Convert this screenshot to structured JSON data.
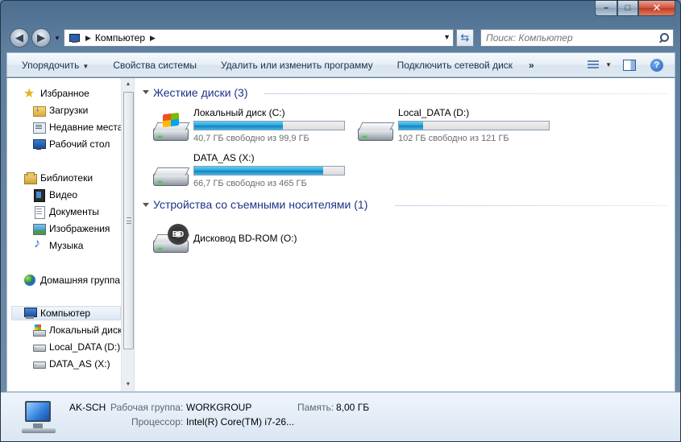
{
  "window": {
    "min": "–",
    "max": "□",
    "close": "✕"
  },
  "address": {
    "path": "Компьютер",
    "search_placeholder": "Поиск: Компьютер"
  },
  "toolbar": {
    "organize": "Упорядочить",
    "system_properties": "Свойства системы",
    "uninstall": "Удалить или изменить программу",
    "map_drive": "Подключить сетевой диск",
    "more": "»"
  },
  "nav": {
    "favorites": "Избранное",
    "downloads": "Загрузки",
    "recent": "Недавние места",
    "desktop": "Рабочий стол",
    "libraries": "Библиотеки",
    "video": "Видео",
    "documents": "Документы",
    "images": "Изображения",
    "music": "Музыка",
    "homegroup": "Домашняя группа",
    "computer": "Компьютер",
    "drive_c": "Локальный диск",
    "drive_d": "Local_DATA (D:)",
    "drive_x": "DATA_AS (X:)"
  },
  "groups": {
    "hdd": "Жесткие диски (3)",
    "removable": "Устройства со съемными носителями (1)"
  },
  "drives": [
    {
      "name": "Локальный диск (C:)",
      "free": "40,7 ГБ свободно из 99,9 ГБ",
      "used_fraction": 0.59
    },
    {
      "name": "Local_DATA (D:)",
      "free": "102 ГБ свободно из 121 ГБ",
      "used_fraction": 0.16
    },
    {
      "name": "DATA_AS (X:)",
      "free": "66,7 ГБ свободно из 465 ГБ",
      "used_fraction": 0.86
    }
  ],
  "removable": {
    "name": "Дисковод BD-ROM (O:)",
    "badge": "BD"
  },
  "details": {
    "computer_name": "AK-SCH",
    "workgroup_label": "Рабочая группа:",
    "workgroup_value": "WORKGROUP",
    "memory_label": "Память:",
    "memory_value": "8,00 ГБ",
    "cpu_label": "Процессор:",
    "cpu_value": "Intel(R) Core(TM) i7-26..."
  }
}
